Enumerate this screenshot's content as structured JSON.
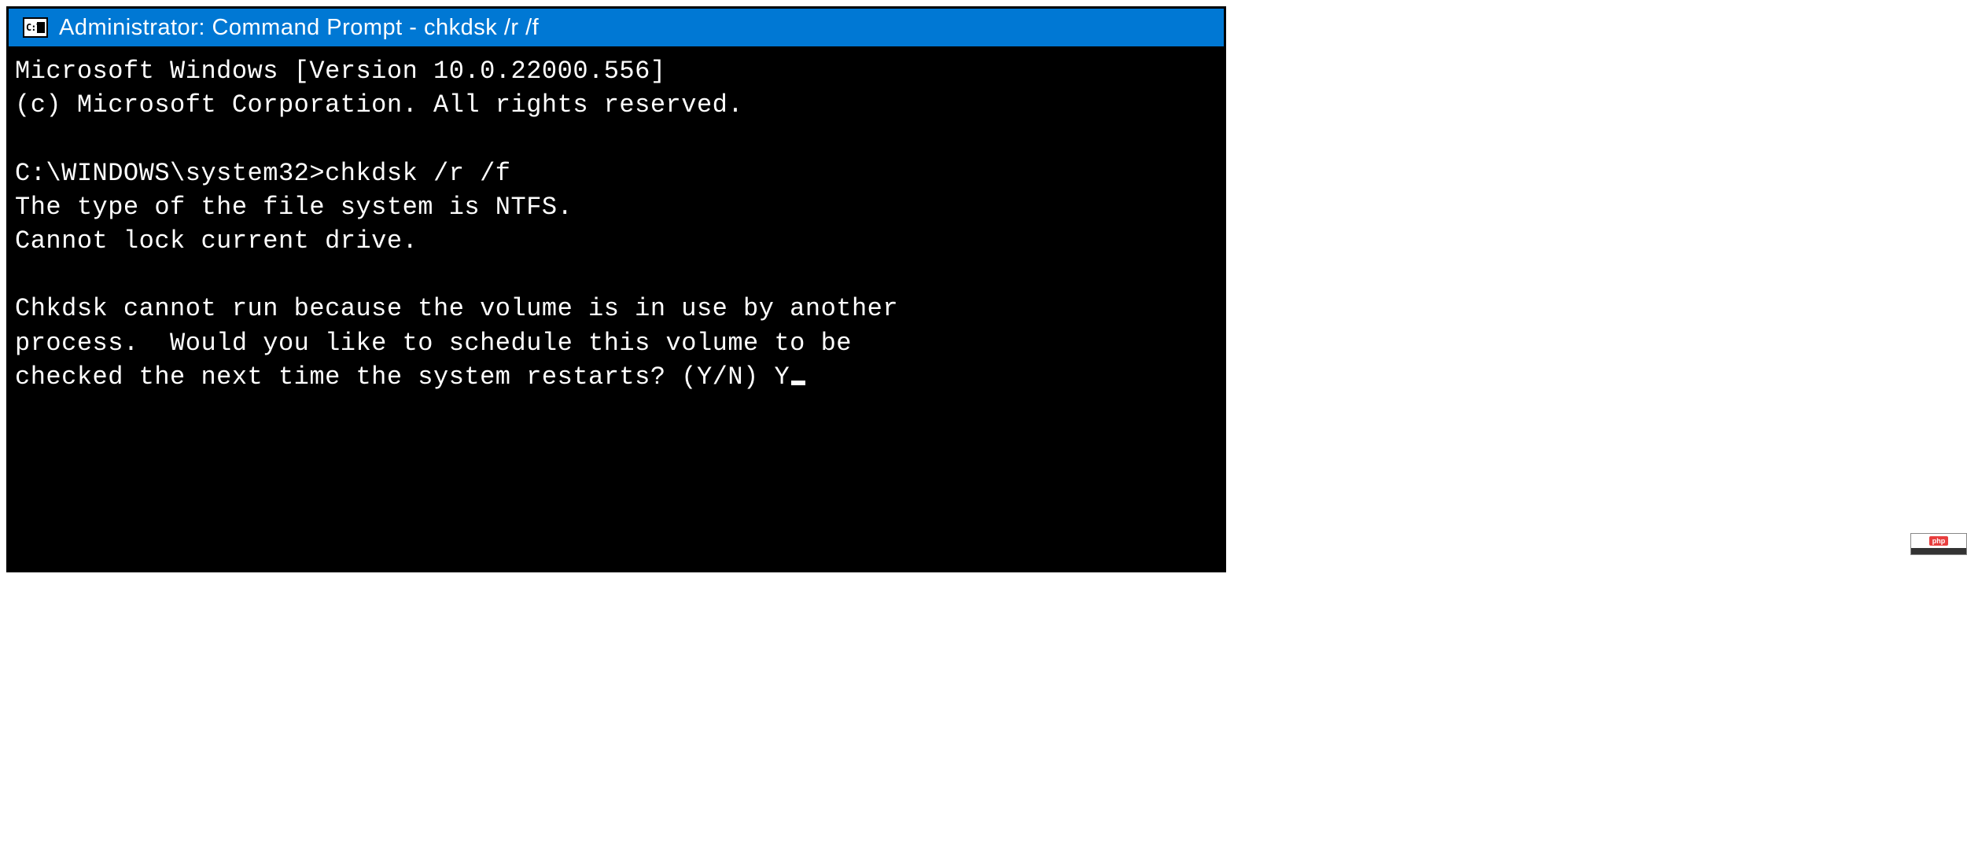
{
  "titlebar": {
    "title": "Administrator: Command Prompt - chkdsk  /r /f"
  },
  "terminal": {
    "line1": "Microsoft Windows [Version 10.0.22000.556]",
    "line2": "(c) Microsoft Corporation. All rights reserved.",
    "blank1": "",
    "prompt_line": "C:\\WINDOWS\\system32>chkdsk /r /f",
    "out1": "The type of the file system is NTFS.",
    "out2": "Cannot lock current drive.",
    "blank2": "",
    "out3": "Chkdsk cannot run because the volume is in use by another",
    "out4": "process.  Would you like to schedule this volume to be",
    "out5": "checked the next time the system restarts? (Y/N) Y"
  },
  "watermark": {
    "label": "php"
  }
}
